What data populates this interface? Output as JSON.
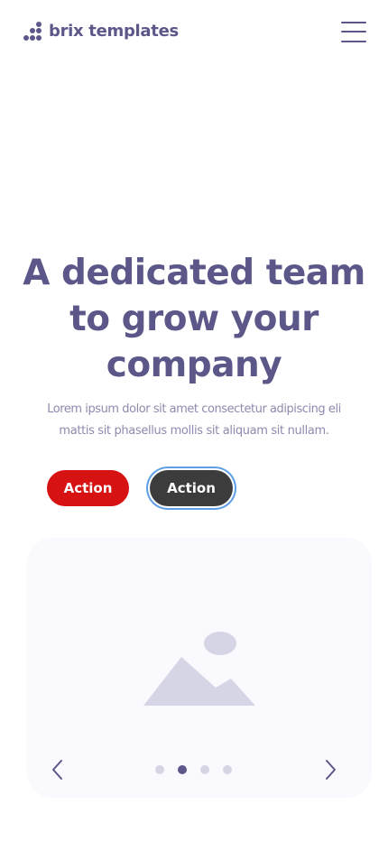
{
  "header": {
    "logo_text": "brix templates",
    "menu_icon": "hamburger-menu-icon"
  },
  "hero": {
    "title": "A dedicated team to grow your company",
    "description_line1": "Lorem ipsum dolor sit amet consectetur adipiscing eli",
    "description_line2": "mattis sit phasellus mollis sit aliquam sit nullam."
  },
  "buttons": {
    "primary_label": "Action",
    "secondary_label": "Action"
  },
  "carousel": {
    "image_icon": "image-placeholder-icon",
    "prev_icon": "chevron-left-icon",
    "next_icon": "chevron-right-icon",
    "slide_count": 4,
    "active_index": 1
  },
  "colors": {
    "brand": "#5b5889",
    "primary_button": "#d71212",
    "secondary_button": "#3c3c3c",
    "focus_ring": "#5d9fe6",
    "card_background": "#f9f9fe",
    "placeholder": "#d6d5e6"
  }
}
